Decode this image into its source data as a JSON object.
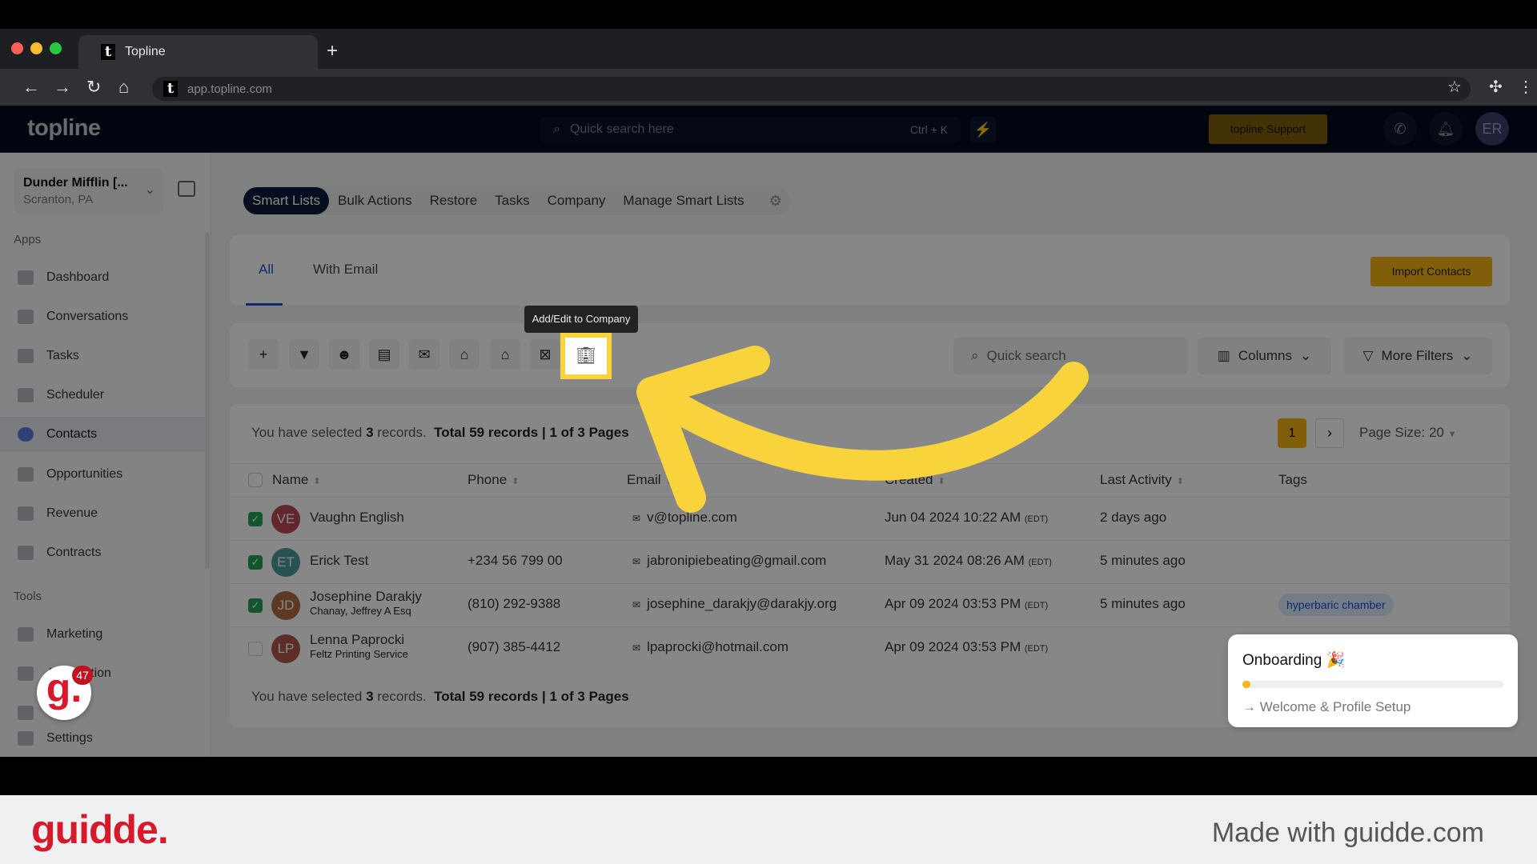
{
  "browser": {
    "tab_title": "Topline",
    "url": "app.topline.com",
    "new_tab": "+"
  },
  "header": {
    "logo": "topline",
    "search_placeholder": "Quick search here",
    "shortcut": "Ctrl + K",
    "support_label": "topline Support",
    "avatar": "ER"
  },
  "sidebar": {
    "company_name": "Dunder Mifflin [...",
    "company_location": "Scranton, PA",
    "apps_label": "Apps",
    "apps": [
      {
        "label": "Dashboard"
      },
      {
        "label": "Conversations"
      },
      {
        "label": "Tasks"
      },
      {
        "label": "Scheduler"
      },
      {
        "label": "Contacts",
        "active": true
      },
      {
        "label": "Opportunities"
      },
      {
        "label": "Revenue"
      },
      {
        "label": "Contracts"
      }
    ],
    "tools_label": "Tools",
    "tools": [
      {
        "label": "Marketing"
      },
      {
        "label": "Automation"
      },
      {
        "label": ""
      },
      {
        "label": "Settings"
      }
    ],
    "badge": "47"
  },
  "nav_tabs": [
    {
      "label": "Smart Lists",
      "active": true
    },
    {
      "label": "Bulk Actions"
    },
    {
      "label": "Restore"
    },
    {
      "label": "Tasks"
    },
    {
      "label": "Company"
    },
    {
      "label": "Manage Smart Lists"
    }
  ],
  "list_tabs": [
    {
      "label": "All",
      "active": true
    },
    {
      "label": "With Email"
    }
  ],
  "import_label": "Import Contacts",
  "toolbar": {
    "icons": [
      "plus-icon",
      "filter-icon",
      "robot-icon",
      "message-icon",
      "email-icon",
      "tag-add-icon",
      "tag-remove-icon",
      "delete-icon",
      "company-icon"
    ],
    "tooltip": "Add/Edit to Company",
    "search_placeholder": "Quick search",
    "columns_label": "Columns",
    "more_filters_label": "More Filters"
  },
  "summary": {
    "selected_prefix": "You have selected",
    "selected_count": "3",
    "selected_suffix": "records.",
    "total": "Total 59 records",
    "pages": "1 of 3 Pages",
    "current_page": "1",
    "page_size": "Page Size: 20"
  },
  "table": {
    "columns": [
      "Name",
      "Phone",
      "Email",
      "Created",
      "Last Activity",
      "Tags"
    ],
    "rows": [
      {
        "checked": true,
        "initials": "VE",
        "color": "#b84a55",
        "name": "Vaughn English",
        "sub": "",
        "phone": "",
        "email": "v@topline.com",
        "created": "Jun 04 2024 10:22 AM",
        "tz": "(EDT)",
        "activity": "2 days ago",
        "tag": ""
      },
      {
        "checked": true,
        "initials": "ET",
        "color": "#4a9a9e",
        "name": "Erick Test",
        "sub": "",
        "phone": "+234 56 799 00",
        "email": "jabronipiebeating@gmail.com",
        "created": "May 31 2024 08:26 AM",
        "tz": "(EDT)",
        "activity": "5 minutes ago",
        "tag": ""
      },
      {
        "checked": true,
        "initials": "JD",
        "color": "#b06a40",
        "name": "Josephine Darakjy",
        "sub": "Chanay, Jeffrey A Esq",
        "phone": "(810) 292-9388",
        "email": "josephine_darakjy@darakjy.org",
        "created": "Apr 09 2024 03:53 PM",
        "tz": "(EDT)",
        "activity": "5 minutes ago",
        "tag": "hyperbaric chamber"
      },
      {
        "checked": false,
        "initials": "LP",
        "color": "#b0584a",
        "name": "Lenna Paprocki",
        "sub": "Feltz Printing Service",
        "phone": "(907) 385-4412",
        "email": "lpaprocki@hotmail.com",
        "created": "Apr 09 2024 03:53 PM",
        "tz": "(EDT)",
        "activity": "",
        "tag": ""
      }
    ]
  },
  "onboarding": {
    "title": "Onboarding 🎉",
    "progress_percent": 2,
    "step": "→ Welcome & Profile Setup"
  },
  "guidde": {
    "logo": "guidde.",
    "made_with": "Made with guidde.com"
  },
  "colors": {
    "accent": "#f4b414",
    "navy": "#0b1a3a",
    "highlight": "#f9d33c",
    "check": "#22a05a"
  }
}
